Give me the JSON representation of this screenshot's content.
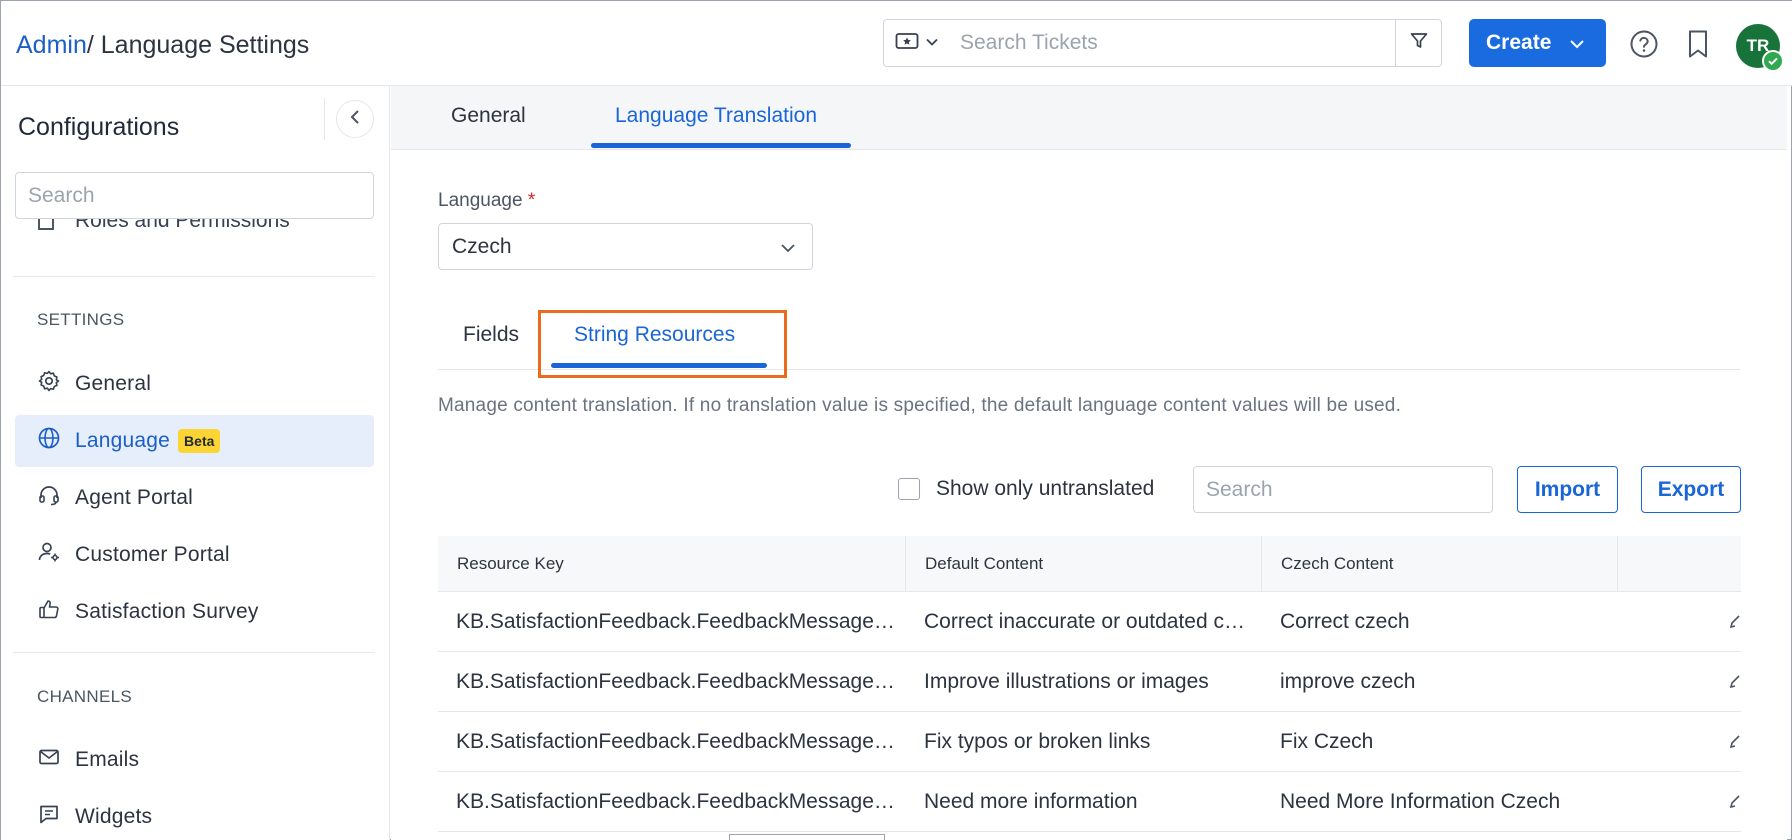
{
  "header": {
    "breadcrumb_root": "Admin",
    "breadcrumb_current": "/ Language Settings",
    "search_placeholder": "Search Tickets",
    "create_label": "Create",
    "avatar_initials": "TR",
    "icons": [
      "ticket-icon",
      "chevron-down-icon",
      "filter-icon",
      "help-icon",
      "bookmark-icon",
      "check-icon"
    ],
    "accent_color": "#1a6be0"
  },
  "sidebar": {
    "title": "Configurations",
    "search_placeholder": "Search",
    "cutoff_item": "Roles and Permissions",
    "sections": [
      {
        "label": "SETTINGS",
        "items": [
          {
            "label": "General",
            "icon": "gear-icon"
          },
          {
            "label": "Language",
            "icon": "globe-icon",
            "badge": "Beta",
            "active": true
          },
          {
            "label": "Agent Portal",
            "icon": "headset-icon"
          },
          {
            "label": "Customer Portal",
            "icon": "user-gear-icon"
          },
          {
            "label": "Satisfaction Survey",
            "icon": "thumbs-up-icon"
          }
        ]
      },
      {
        "label": "CHANNELS",
        "items": [
          {
            "label": "Emails",
            "icon": "envelope-icon"
          },
          {
            "label": "Widgets",
            "icon": "chat-icon"
          }
        ]
      }
    ]
  },
  "main": {
    "tabs": [
      {
        "label": "General",
        "active": false
      },
      {
        "label": "Language Translation",
        "active": true
      }
    ],
    "language_label": "Language",
    "required_mark": "*",
    "language_value": "Czech",
    "subtabs": [
      {
        "label": "Fields",
        "active": false
      },
      {
        "label": "String Resources",
        "active": true
      }
    ],
    "description": "Manage content translation. If no translation value is specified, the default language content values will be used.",
    "untranslated_label": "Show only untranslated",
    "untranslated_checked": false,
    "table_search_placeholder": "Search",
    "import_label": "Import",
    "export_label": "Export",
    "highlight_color": "#ea6a1e",
    "table": {
      "columns": [
        "Resource Key",
        "Default Content",
        "Czech Content",
        ""
      ],
      "rows": [
        {
          "key": "KB.SatisfactionFeedback.FeedbackMessage…",
          "default": "Correct inaccurate or outdated c…",
          "czech": "Correct czech"
        },
        {
          "key": "KB.SatisfactionFeedback.FeedbackMessage…",
          "default": "Improve illustrations or images",
          "czech": "improve czech"
        },
        {
          "key": "KB.SatisfactionFeedback.FeedbackMessage…",
          "default": "Fix typos or broken links",
          "czech": "Fix Czech"
        },
        {
          "key": "KB.SatisfactionFeedback.FeedbackMessage…",
          "default": "Need more information",
          "czech": "Need More Information Czech"
        }
      ]
    }
  }
}
